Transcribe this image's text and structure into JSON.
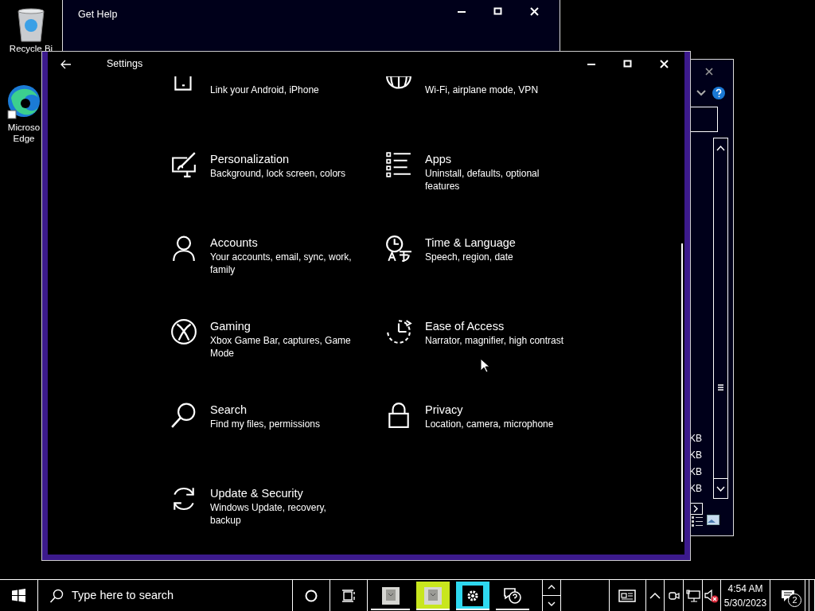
{
  "desktop_icons": [
    {
      "kind": "recycle_bin",
      "label": "Recycle Bi"
    },
    {
      "kind": "edge",
      "label": "Microso Edge"
    }
  ],
  "get_help_window": {
    "title": "Get Help"
  },
  "background_window": {
    "sizes": [
      "KB",
      "KB",
      "KB",
      "KB"
    ]
  },
  "settings_window": {
    "title": "Settings",
    "items": [
      {
        "kind": "phone",
        "description": "Link your Android, iPhone"
      },
      {
        "kind": "network",
        "description": "Wi-Fi, airplane mode, VPN"
      },
      {
        "kind": "personalization",
        "title": "Personalization",
        "description": "Background, lock screen, colors"
      },
      {
        "kind": "apps",
        "title": "Apps",
        "description": "Uninstall, defaults, optional features"
      },
      {
        "kind": "accounts",
        "title": "Accounts",
        "description": "Your accounts, email, sync, work, family"
      },
      {
        "kind": "time",
        "title": "Time & Language",
        "description": "Speech, region, date"
      },
      {
        "kind": "gaming",
        "title": "Gaming",
        "description": "Xbox Game Bar, captures, Game Mode"
      },
      {
        "kind": "ease",
        "title": "Ease of Access",
        "description": "Narrator, magnifier, high contrast"
      },
      {
        "kind": "search",
        "title": "Search",
        "description": "Find my files, permissions"
      },
      {
        "kind": "privacy",
        "title": "Privacy",
        "description": "Location, camera, microphone"
      },
      {
        "kind": "update",
        "title": "Update & Security",
        "description": "Windows Update, recovery, backup"
      }
    ]
  },
  "taskbar": {
    "search": {
      "placeholder": "Type here to search"
    },
    "apps": [
      {
        "kind": "app"
      },
      {
        "kind": "app",
        "color": "#c8e61e"
      },
      {
        "kind": "settings",
        "color": "#2ed8f0"
      },
      {
        "kind": "help"
      }
    ],
    "time": "4:54 AM",
    "date": "5/30/2023",
    "notifications": "2"
  }
}
